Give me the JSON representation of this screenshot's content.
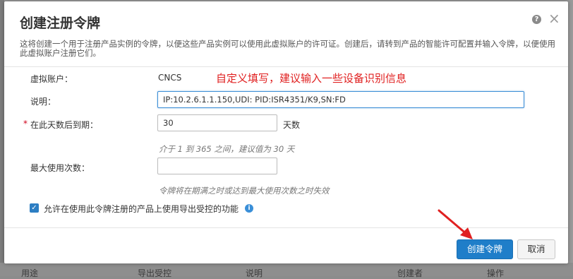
{
  "dialog": {
    "title": "创建注册令牌",
    "help_icon": "question-circle-icon",
    "close_glyph": "×",
    "description": "这将创建一个用于注册产品实例的令牌，以便这些产品实例可以使用此虚拟账户的许可证。创建后，请转到产品的智能许可配置并输入令牌，以便使用此虚拟账户注册它们。"
  },
  "fields": {
    "virtual_account_label": "虚拟账户：",
    "virtual_account_value": "CNCS",
    "description_label": "说明：",
    "description_value": "IP:10.2.6.1.1.150,UDI: PID:ISR4351/K9,SN:FD",
    "expire_required": "*",
    "expire_label": "在此天数后到期：",
    "expire_value": "30",
    "expire_suffix": "天数",
    "expire_hint": "介于 1 到 365 之间，建议值为 30 天",
    "max_uses_label": "最大使用次数：",
    "max_uses_value": "",
    "max_uses_hint": "令牌将在期满之时或达到最大使用次数之时失效",
    "export_checkbox_label": "允许在使用此令牌注册的产品上使用导出受控的功能",
    "export_checked": true
  },
  "annotation": {
    "text": "自定义填写，建议输入一些设备识别信息",
    "color": "#e02020"
  },
  "buttons": {
    "create_label": "创建令牌",
    "cancel_label": "取消"
  },
  "background": {
    "columns": [
      "用途",
      "导出受控",
      "说明",
      "创建者",
      "操作"
    ]
  },
  "colors": {
    "primary": "#1f7ec9",
    "required": "#d0021b",
    "annotation": "#e02020"
  }
}
